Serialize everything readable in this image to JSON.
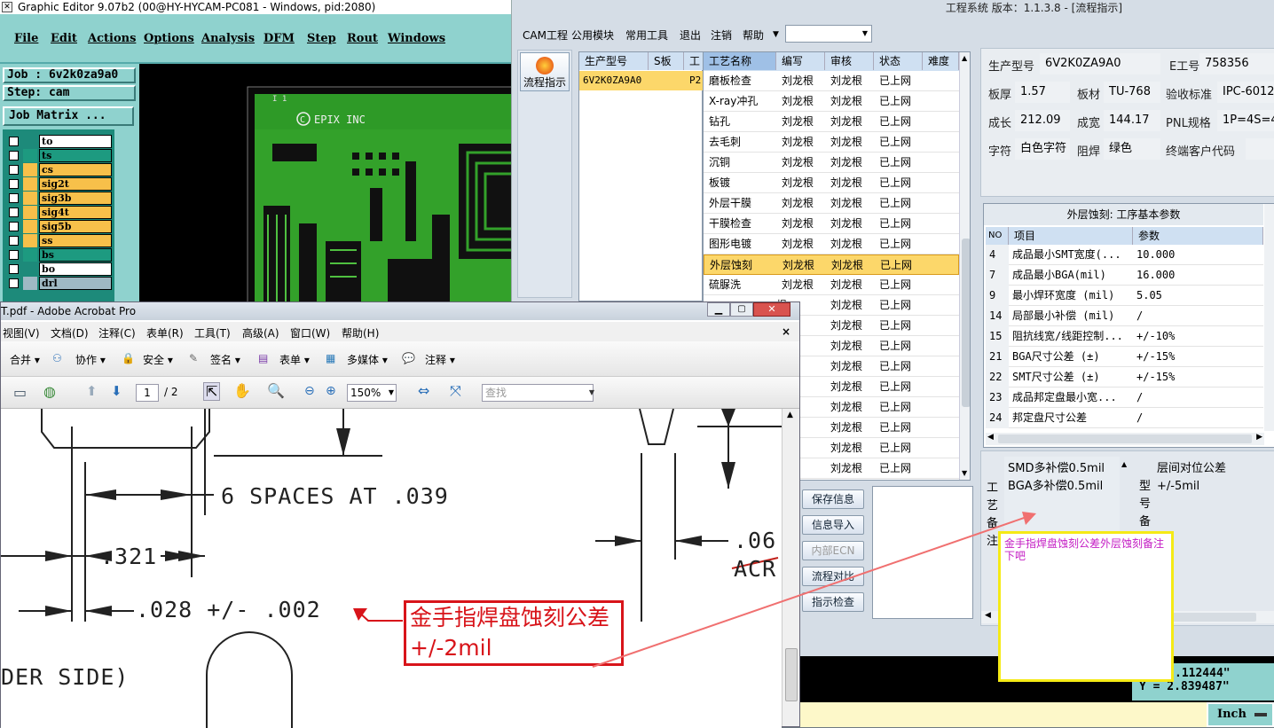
{
  "graphic_editor": {
    "title": "Graphic Editor 9.07b2 (00@HY-HYCAM-PC081 - Windows, pid:2080)",
    "menu": [
      "File",
      "Edit",
      "Actions",
      "Options",
      "Analysis",
      "DFM",
      "Step",
      "Rout",
      "Windows"
    ],
    "job": "Job : 6v2k0za9a0",
    "step": "Step: cam",
    "matrix_button": "Job Matrix ...",
    "layers": [
      {
        "name": "to",
        "color": "#ffffff"
      },
      {
        "name": "ts",
        "color": "#1d9a80"
      },
      {
        "name": "cs",
        "color": "#f7c04a"
      },
      {
        "name": "sig2t",
        "color": "#f7c04a"
      },
      {
        "name": "sig3b",
        "color": "#f7c04a"
      },
      {
        "name": "sig4t",
        "color": "#f7c04a"
      },
      {
        "name": "sig5b",
        "color": "#f7c04a"
      },
      {
        "name": "ss",
        "color": "#f7c04a"
      },
      {
        "name": "bs",
        "color": "#1d9a80"
      },
      {
        "name": "bo",
        "color": "#ffffff"
      },
      {
        "name": "drl",
        "color": "#9fb9c4"
      }
    ],
    "board_text": "EPIX INC",
    "board_marker": "I 1",
    "coords": {
      "x": ".112444\"",
      "y": "Y = 2.839487\""
    },
    "units": "Inch"
  },
  "eng_system": {
    "title": "工程系统   版本：1.1.3.8 - [流程指示]",
    "menu": [
      "CAM工程",
      "公用模块",
      "常用工具",
      "退出",
      "注销",
      "帮助"
    ],
    "flow_button": "流程指示",
    "model_table": {
      "headers": [
        "生产型号",
        "S板",
        "工"
      ],
      "row": [
        "6V2K0ZA9A0",
        "",
        "P2"
      ]
    },
    "process_table": {
      "headers": [
        "工艺名称",
        "编写",
        "审核",
        "状态",
        "难度"
      ],
      "rows": [
        [
          "磨板检查",
          "刘龙根",
          "刘龙根",
          "已上网"
        ],
        [
          "X-ray冲孔",
          "刘龙根",
          "刘龙根",
          "已上网"
        ],
        [
          "钻孔",
          "刘龙根",
          "刘龙根",
          "已上网"
        ],
        [
          "去毛刺",
          "刘龙根",
          "刘龙根",
          "已上网"
        ],
        [
          "沉铜",
          "刘龙根",
          "刘龙根",
          "已上网"
        ],
        [
          "板镀",
          "刘龙根",
          "刘龙根",
          "已上网"
        ],
        [
          "外层干膜",
          "刘龙根",
          "刘龙根",
          "已上网"
        ],
        [
          "干膜检查",
          "刘龙根",
          "刘龙根",
          "已上网"
        ],
        [
          "图形电镀",
          "刘龙根",
          "刘龙根",
          "已上网"
        ],
        [
          "外层蚀刻",
          "刘龙根",
          "刘龙根",
          "已上网"
        ],
        [
          "硫脲洗",
          "刘龙根",
          "刘龙根",
          "已上网"
        ],
        [
          "",
          "根",
          "刘龙根",
          "已上网"
        ],
        [
          "",
          "根",
          "刘龙根",
          "已上网"
        ],
        [
          "",
          "根",
          "刘龙根",
          "已上网"
        ],
        [
          "",
          "根",
          "刘龙根",
          "已上网"
        ],
        [
          "",
          "根",
          "刘龙根",
          "已上网"
        ],
        [
          "",
          "根",
          "刘龙根",
          "已上网"
        ],
        [
          "",
          "根",
          "刘龙根",
          "已上网"
        ],
        [
          "",
          "根",
          "刘龙根",
          "已上网"
        ],
        [
          "",
          "根",
          "刘龙根",
          "已上网"
        ]
      ],
      "selected": "外层蚀刻"
    },
    "info": {
      "model_label": "生产型号",
      "model": "6V2K0ZA9A0",
      "eno_label": "E工号",
      "eno": "758356",
      "thick_label": "板厚",
      "thick": "1.57",
      "mat_label": "板材",
      "mat": "TU-768",
      "std_label": "验收标准",
      "std": "IPC-6012",
      "len_label": "成长",
      "len": "212.09",
      "wid_label": "成宽",
      "wid": "144.17",
      "pnl_label": "PNL规格",
      "pnl": "1P=4S=4",
      "char_label": "字符",
      "char": "白色字符",
      "mask_label": "阻焊",
      "mask": "绿色",
      "cust_label": "终端客户代码",
      "cust": ""
    },
    "param_title": "外层蚀刻: 工序基本参数",
    "param_headers": [
      "NO",
      "项目",
      "参数"
    ],
    "params": [
      [
        "4",
        "成品最小SMT宽度(...",
        "10.000"
      ],
      [
        "7",
        "成品最小BGA(mil)",
        "16.000"
      ],
      [
        "9",
        "最小焊环宽度 (mil)",
        "5.05"
      ],
      [
        "14",
        "局部最小补偿 (mil)",
        "/"
      ],
      [
        "15",
        "阻抗线宽/线距控制...",
        "+/-10%"
      ],
      [
        "21",
        "BGA尺寸公差 (±)",
        "+/-15%"
      ],
      [
        "22",
        "SMT尺寸公差 (±)",
        "+/-15%"
      ],
      [
        "23",
        "成品邦定盘最小宽...",
        "/"
      ],
      [
        "24",
        "邦定盘尺寸公差",
        "/"
      ]
    ],
    "buttons": [
      "保存信息",
      "信息导入",
      "内部ECN",
      "流程对比",
      "指示检查"
    ],
    "remark_label": "工艺备注",
    "remark_text_1": "SMD多补偿0.5mil",
    "remark_text_2": "BGA多补偿0.5mil",
    "model_remark_label": "型号备",
    "model_remark_text": "层间对位公差+/-5mil",
    "note": "金手指焊盘蚀刻公差外层蚀刻备注下吧"
  },
  "acrobat": {
    "title": "T.pdf - Adobe Acrobat Pro",
    "menu": [
      "视图(V)",
      "文档(D)",
      "注释(C)",
      "表单(R)",
      "工具(T)",
      "高级(A)",
      "窗口(W)",
      "帮助(H)"
    ],
    "toolbar1": [
      "合并",
      "协作",
      "安全",
      "签名",
      "表单",
      "多媒体",
      "注释"
    ],
    "page_current": "1",
    "page_total": "/ 2",
    "zoom": "150%",
    "search_placeholder": "查找",
    "drawing": {
      "spaces": "6 SPACES AT .039",
      "d321": ".321",
      "d028": ".028 +/- .002",
      "d06": ".06",
      "acr": "ACR",
      "side": "DER SIDE)"
    },
    "annotation": "金手指焊盘蚀刻公差+/-2mil"
  }
}
